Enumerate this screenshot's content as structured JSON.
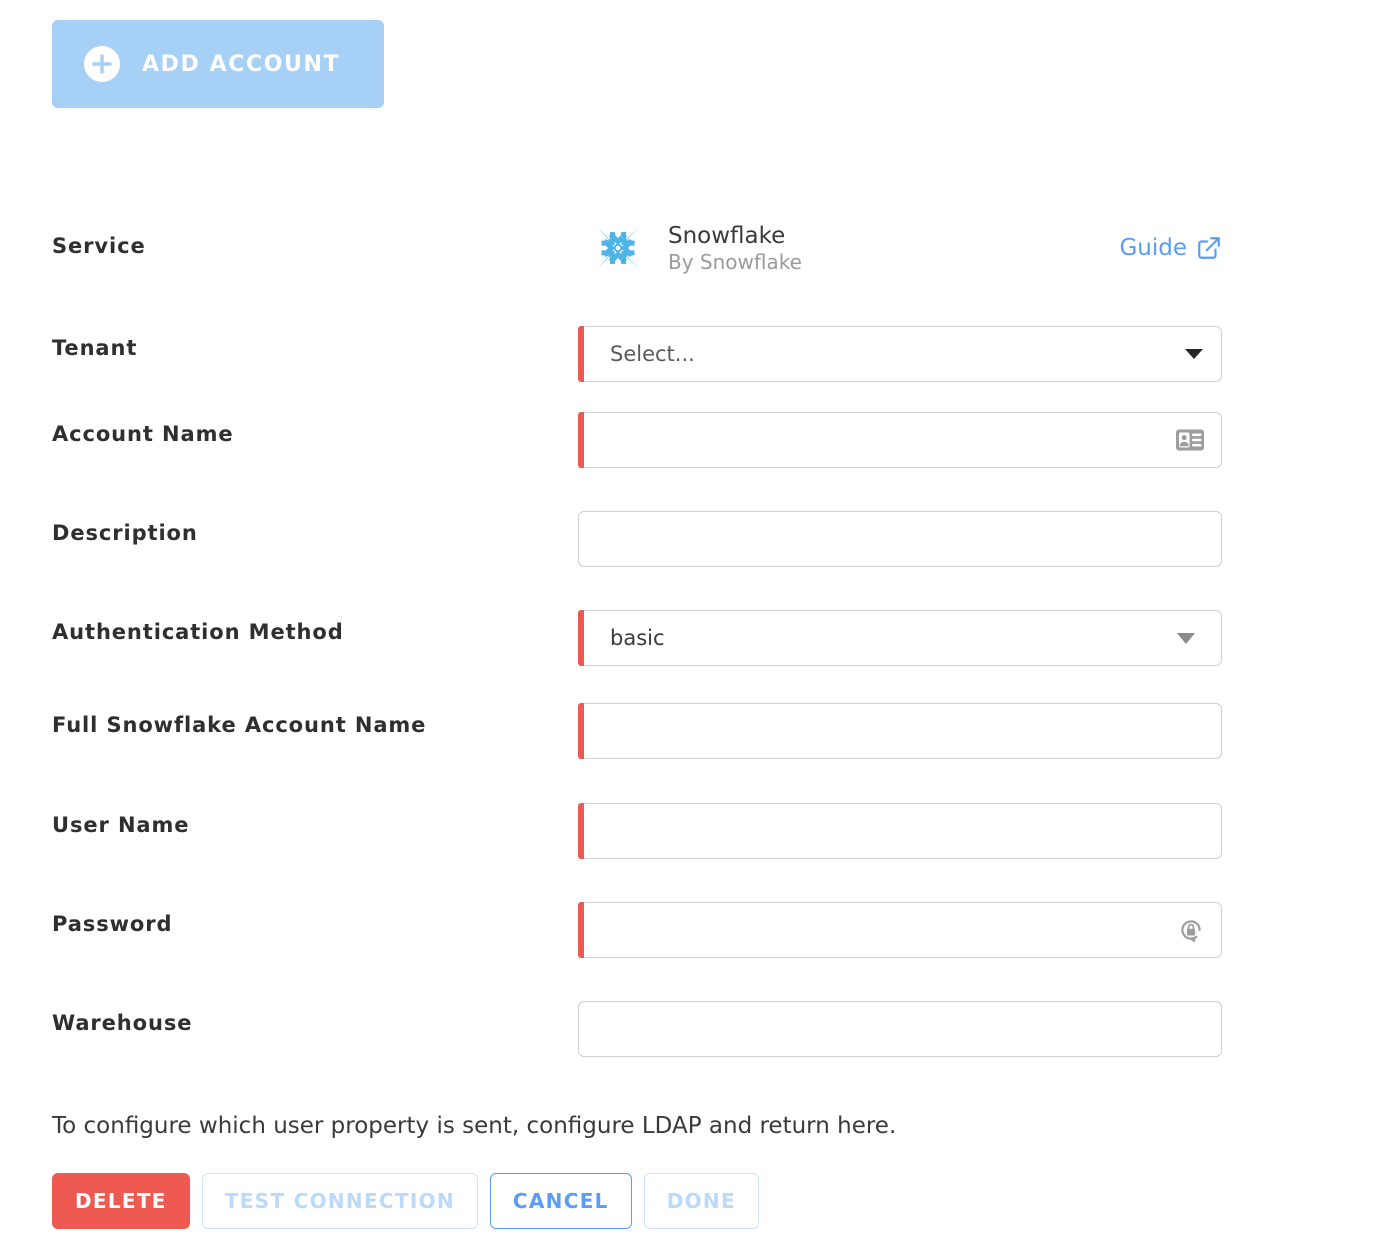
{
  "top_action": {
    "label": "ADD ACCOUNT",
    "icon": "plus-circle-icon",
    "bg_color": "#A6D0F5"
  },
  "service_row": {
    "label": "Service",
    "logo_icon": "snowflake-logo-icon",
    "name": "Snowflake",
    "vendor": "By Snowflake",
    "guide_label": "Guide",
    "guide_icon": "external-link-icon",
    "link_color": "#5A9CF8",
    "logo_color": "#4FB5E8"
  },
  "fields": [
    {
      "label": "Tenant",
      "type": "select",
      "value": "Select...",
      "required": true,
      "icon": "chevron-down-icon"
    },
    {
      "label": "Account Name",
      "type": "text",
      "value": "",
      "placeholder": "",
      "required": true,
      "icon": "id-card-icon"
    },
    {
      "label": "Description",
      "type": "text",
      "value": "",
      "placeholder": "",
      "required": false,
      "icon": ""
    },
    {
      "label": "Authentication Method",
      "type": "select",
      "value": "basic",
      "required": true,
      "icon": "caret-down-icon",
      "options": [
        "basic"
      ]
    },
    {
      "label": "Full Snowflake Account Name",
      "type": "text",
      "value": "",
      "placeholder": "",
      "required": true,
      "icon": ""
    },
    {
      "label": "User Name",
      "type": "text",
      "value": "",
      "placeholder": "",
      "required": true,
      "icon": ""
    },
    {
      "label": "Password",
      "type": "password",
      "value": "",
      "placeholder": "",
      "required": true,
      "icon": "password-reset-lock-icon"
    },
    {
      "label": "Warehouse",
      "type": "text",
      "value": "",
      "placeholder": "",
      "required": false,
      "icon": ""
    }
  ],
  "footer": {
    "note": "To configure which user property is sent, configure LDAP and return here.",
    "buttons": [
      {
        "label": "DELETE",
        "style": "delete"
      },
      {
        "label": "TEST CONNECTION",
        "style": "disabled"
      },
      {
        "label": "CANCEL",
        "style": "outline"
      },
      {
        "label": "DONE",
        "style": "disabled"
      }
    ]
  },
  "colors": {
    "required_bar": "#EE5A52",
    "delete": "#EE5A52",
    "accent_blue": "#5A9CF8",
    "disabled_blue": "#BBD9FB"
  }
}
